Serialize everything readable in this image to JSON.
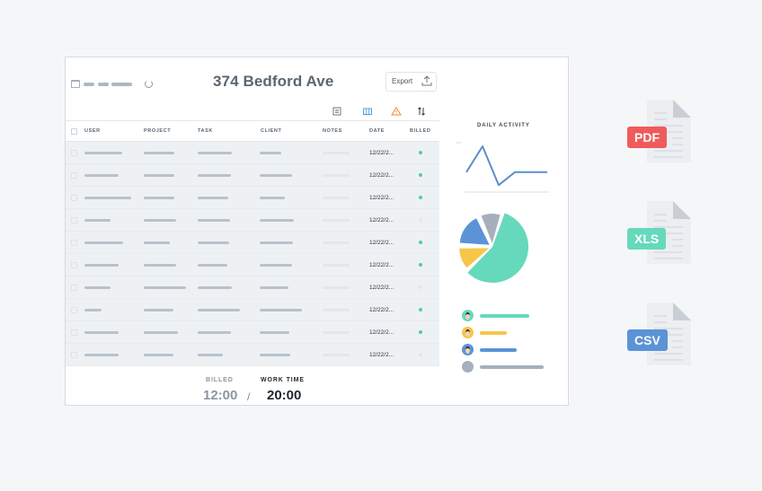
{
  "header": {
    "title": "374 Bedford Ave",
    "export_label": "Export"
  },
  "table": {
    "columns": [
      "USER",
      "PROJECT",
      "TASK",
      "CLIENT",
      "NOTES",
      "DATE",
      "BILLED"
    ],
    "rows": [
      {
        "date": "12/22/2...",
        "billed": true
      },
      {
        "date": "12/22/2...",
        "billed": true
      },
      {
        "date": "12/22/2...",
        "billed": true
      },
      {
        "date": "12/22/2...",
        "billed": false
      },
      {
        "date": "12/22/2...",
        "billed": true
      },
      {
        "date": "12/22/2...",
        "billed": true
      },
      {
        "date": "12/22/2...",
        "billed": false
      },
      {
        "date": "12/22/2...",
        "billed": true
      },
      {
        "date": "12/22/2...",
        "billed": true
      },
      {
        "date": "12/22/2...",
        "billed": false
      }
    ]
  },
  "totals": {
    "billed_label": "BILLED",
    "billed_value": "12:00",
    "separator": "/",
    "work_label": "WORK TIME",
    "work_value": "20:00"
  },
  "activity": {
    "title": "DAILY ACTIVITY",
    "line_values": [
      4,
      10,
      1,
      4,
      4,
      4
    ],
    "pie_slices": [
      {
        "value": 55,
        "color": "#66d9bd"
      },
      {
        "value": 12,
        "color": "#f7c548"
      },
      {
        "value": 17,
        "color": "#5b93d6"
      },
      {
        "value": 11,
        "color": "#a6b0bd"
      }
    ],
    "users": [
      {
        "color": "#66d9bd",
        "fraction": 0.78
      },
      {
        "color": "#f7c548",
        "fraction": 0.42
      },
      {
        "color": "#5b93d6",
        "fraction": 0.58
      },
      {
        "color": "#a6b0bd",
        "fraction": 1.0
      }
    ]
  },
  "exports": [
    {
      "label": "PDF",
      "color": "#ef5b5b"
    },
    {
      "label": "XLS",
      "color": "#66d9bd"
    },
    {
      "label": "CSV",
      "color": "#5b93d6"
    }
  ],
  "colors": {
    "billed_dot": "#4fcf9f",
    "unbilled_dot": "#e2e6ea",
    "line": "#5b8fc9"
  }
}
